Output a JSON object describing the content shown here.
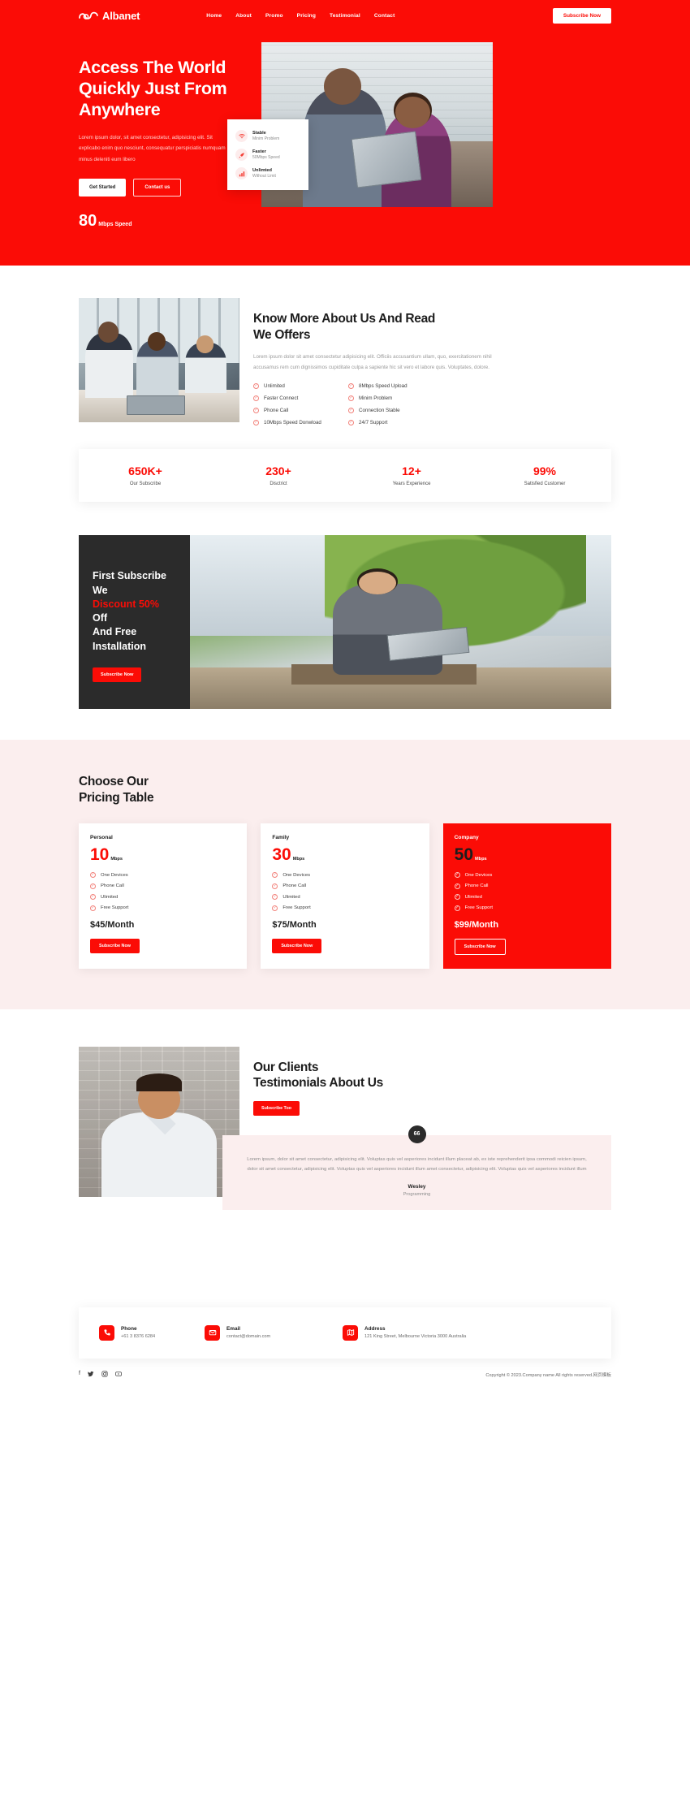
{
  "brand": {
    "name": "Albanet",
    "accent": "#fb0c06",
    "dark": "#2b2b2b",
    "tint": "#fbeeee"
  },
  "nav": {
    "items": [
      {
        "label": "Home"
      },
      {
        "label": "About"
      },
      {
        "label": "Promo"
      },
      {
        "label": "Pricing"
      },
      {
        "label": "Testimonial"
      },
      {
        "label": "Contact"
      }
    ],
    "cta": "Subscribe Now"
  },
  "hero": {
    "title_line1": "Access The World",
    "title_line2": "Quickly Just From",
    "title_line3": "Anywhere",
    "paragraph": "Lorem ipsum dolor, sit amet consectetur, adipisicing elit. Sit explicabo enim quo nesciunt, consequatur perspiciatis numquam minus deleniti eum libero",
    "primary_button": "Get Started",
    "secondary_button": "Contact us",
    "speed_value": "80",
    "speed_unit": "Mbps Speed",
    "features": [
      {
        "icon": "wifi-icon",
        "title": "Stable",
        "subtitle": "Minim Problem"
      },
      {
        "icon": "rocket-icon",
        "title": "Faster",
        "subtitle": "50Mbps Speed"
      },
      {
        "icon": "bars-icon",
        "title": "Unlimted",
        "subtitle": "Without Limit"
      }
    ]
  },
  "about": {
    "title_line1": "Know More About Us And Read",
    "title_line2": "We Offers",
    "paragraph": "Lorem ipsum dolor sit amet consectetur adipisicing elit. Officiis accusantium ullam, quo, exercitationem nihil accusamus rem cum dignissimos cupiditate culpa a sapiente hic sit vero et labore quis. Voluptates, dolore.",
    "features_left": [
      {
        "label": "Unlimited"
      },
      {
        "label": "Faster Connect"
      },
      {
        "label": "Phone Call"
      },
      {
        "label": "10Mbps Speed Donwload"
      }
    ],
    "features_right": [
      {
        "label": "8Mbps Speed Upload"
      },
      {
        "label": "Minim Problem"
      },
      {
        "label": "Connection Stable"
      },
      {
        "label": "24/7 Support"
      }
    ]
  },
  "stats": [
    {
      "number": "650K+",
      "label": "Our Subscribe"
    },
    {
      "number": "230+",
      "label": "Disctrict"
    },
    {
      "number": "12+",
      "label": "Years Experience"
    },
    {
      "number": "99%",
      "label": "Satisfied Customer"
    }
  ],
  "promo": {
    "line1": "First Subscribe We",
    "highlight": "Discount 50%",
    "line2_rest": " Off",
    "line3": "And Free",
    "line4": "Installation",
    "button": "Subscribe Now"
  },
  "pricing": {
    "title_line1": "Choose Our",
    "title_line2": "Pricing Table",
    "plans": [
      {
        "name": "Personal",
        "speed": "10",
        "unit": "Mbps",
        "features": [
          "One Devices",
          "Phone Call",
          "Ulimited",
          "Free Support"
        ],
        "price": "$45/Month",
        "button": "Subscribe Now"
      },
      {
        "name": "Family",
        "speed": "30",
        "unit": "Mbps",
        "features": [
          "One Devices",
          "Phone Call",
          "Ulimited",
          "Free Support"
        ],
        "price": "$75/Month",
        "button": "Subscribe Now"
      },
      {
        "name": "Company",
        "speed": "50",
        "unit": "Mbps",
        "features": [
          "One Devices",
          "Phone Call",
          "Ulimited",
          "Free Support"
        ],
        "price": "$99/Month",
        "button": "Subscribe Now"
      }
    ]
  },
  "testimonial": {
    "title_line1": "Our Clients",
    "title_line2": "Testimonials About Us",
    "button": "Subscribe Too",
    "quote_mark": "66",
    "quote": "Lorem ipsum, dolor sit amet consectetur, adipisicing elit. Voluptas quis vel asperiores incidunt illum placeat ab, ex iste reprehenderit ipsa commodi reicien ipsum, dolor sit amet consectetur, adipisicing elit. Voluptas quis vel asperiores incidunt illum amet consectetur, adipisicing elit. Voluptas quis vel asperiores incidunt illum",
    "author": "Wesley",
    "role": "Programming"
  },
  "footer": {
    "contacts": [
      {
        "icon": "phone-icon",
        "title": "Phone",
        "value": "+61 3 8376 6284"
      },
      {
        "icon": "mail-icon",
        "title": "Email",
        "value": "contact@domain.com"
      },
      {
        "icon": "map-icon",
        "title": "Address",
        "value": "121 King Street, Melbourne Victoria 3000 Australia"
      }
    ],
    "socials": [
      {
        "icon": "facebook-icon",
        "glyph": "f"
      },
      {
        "icon": "twitter-icon",
        "glyph": "ᵥ"
      },
      {
        "icon": "instagram-icon",
        "glyph": "□"
      },
      {
        "icon": "youtube-icon",
        "glyph": "▷"
      }
    ],
    "copyright": "Copyright © 2023.Company name All rights reserved.网页模板"
  }
}
